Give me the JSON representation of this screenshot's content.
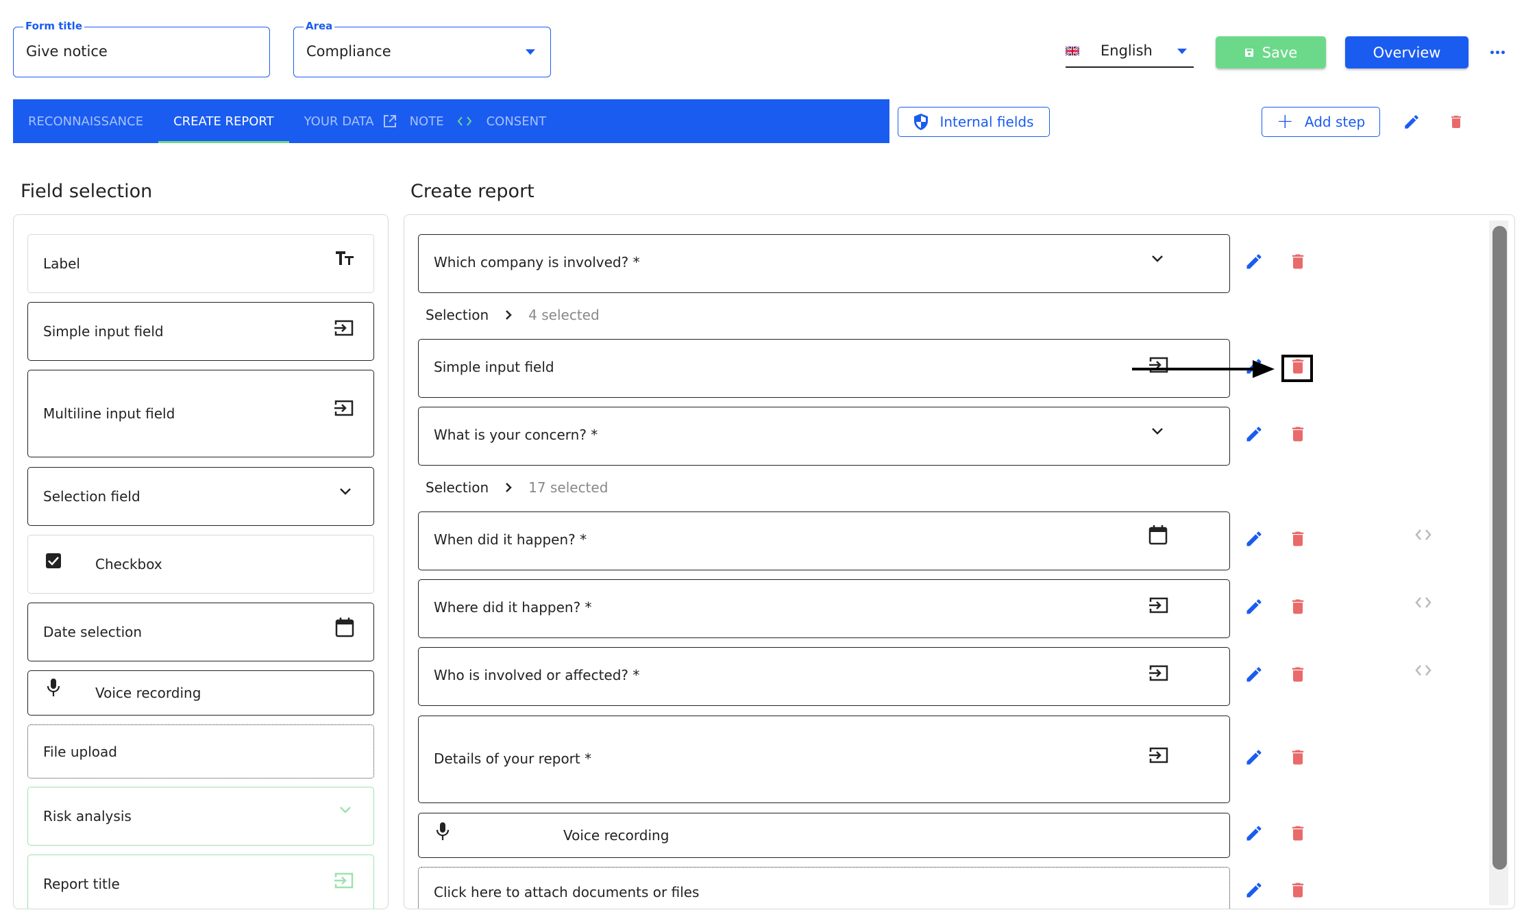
{
  "header": {
    "form_title": {
      "label": "Form title",
      "value": "Give notice"
    },
    "area": {
      "label": "Area",
      "value": "Compliance"
    },
    "language": {
      "value": "English",
      "flag": "uk-flag-icon"
    },
    "save_label": "Save",
    "overview_label": "Overview",
    "more_icon": "more-horizontal-icon"
  },
  "tabs": [
    {
      "label": "RECONNAISSANCE",
      "active": false
    },
    {
      "label": "CREATE REPORT",
      "active": true
    },
    {
      "label": "YOUR DATA",
      "active": false,
      "icon_after": "external-link-icon"
    },
    {
      "label": "NOTE",
      "active": false,
      "icon_after": "code-icon"
    },
    {
      "label": "CONSENT",
      "active": false
    }
  ],
  "toolbar": {
    "internal_fields_label": "Internal fields",
    "add_step_label": "Add step"
  },
  "field_selection": {
    "title": "Field selection",
    "items": [
      {
        "label": "Label",
        "icon": "text-size-icon"
      },
      {
        "label": "Simple input field",
        "icon": "input-icon"
      },
      {
        "label": "Multiline input field",
        "icon": "input-icon"
      },
      {
        "label": "Selection field",
        "icon": "chevron-down-icon"
      },
      {
        "label": "Checkbox",
        "icon": "checkbox-icon"
      },
      {
        "label": "Date selection",
        "icon": "calendar-icon"
      },
      {
        "label": "Voice recording",
        "icon": "microphone-icon"
      },
      {
        "label": "File upload",
        "icon": ""
      },
      {
        "label": "Risk analysis",
        "icon": "chevron-down-icon"
      },
      {
        "label": "Report title",
        "icon": "input-icon"
      }
    ]
  },
  "create_report": {
    "title": "Create report",
    "selection_label": "Selection",
    "fields": [
      {
        "label": "Which company is involved? *",
        "icon": "chevron-down-icon",
        "selection_count": "4 selected"
      },
      {
        "label": "Simple input field",
        "icon": "input-icon"
      },
      {
        "label": "What is your concern? *",
        "icon": "chevron-down-icon",
        "selection_count": "17 selected"
      },
      {
        "label": "When did it happen? *",
        "icon": "calendar-icon",
        "code": true
      },
      {
        "label": "Where did it happen? *",
        "icon": "input-icon",
        "code": true
      },
      {
        "label": "Who is involved or affected? *",
        "icon": "input-icon",
        "code": true
      },
      {
        "label": "Details of your report *",
        "icon": "input-icon"
      },
      {
        "label": "Voice recording",
        "icon": "microphone-icon"
      },
      {
        "label": "Click here to attach documents or files",
        "icon": ""
      }
    ]
  },
  "colors": {
    "primary": "#1a5cf0",
    "save_green": "#6cd98a",
    "delete_red": "#e96a6a",
    "tab_inactive_text": "#a9c1fb"
  }
}
